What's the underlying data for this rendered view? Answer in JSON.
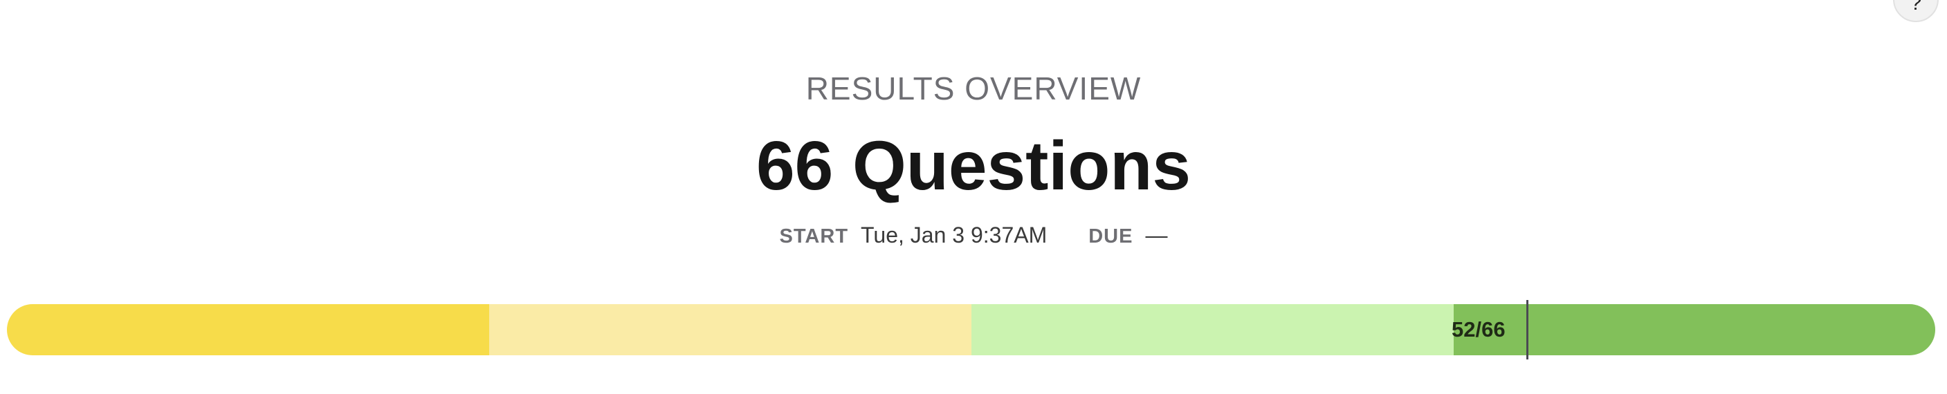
{
  "help": {
    "label": "?",
    "icon": "question-mark-icon"
  },
  "header": {
    "overview_label": "RESULTS OVERVIEW",
    "title": "66 Questions"
  },
  "meta": {
    "start_label": "START",
    "start_value": "Tue, Jan 3 9:37AM",
    "due_label": "DUE",
    "due_value": "—"
  },
  "progress": {
    "score_text": "52/66",
    "correct": 52,
    "total": 66,
    "segment_colors": [
      "#f7dc4a",
      "#faeba6",
      "#cbf3b0",
      "#82c05a"
    ],
    "marker_color": "#4a4a52"
  }
}
